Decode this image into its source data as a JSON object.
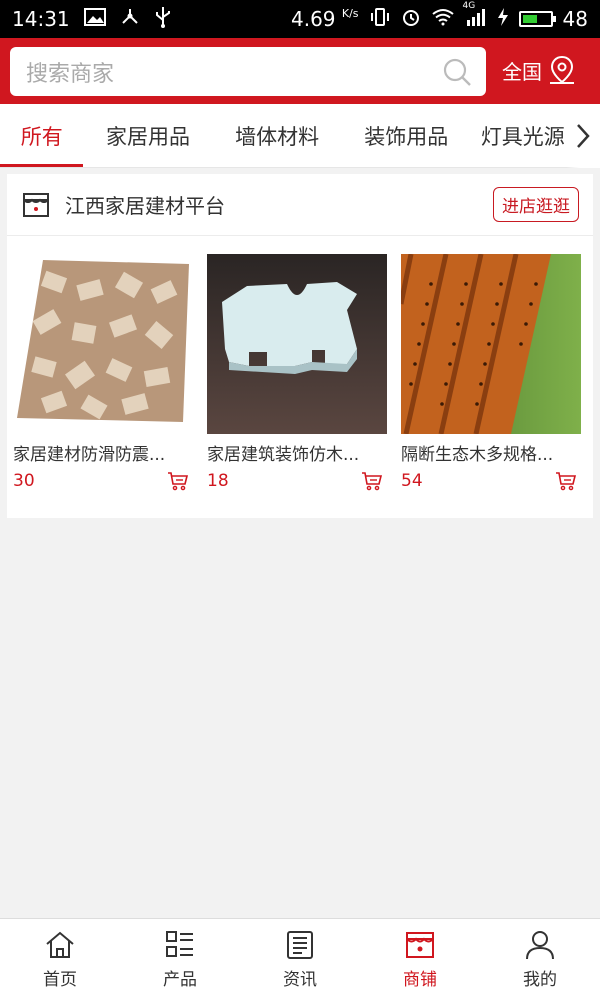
{
  "status_bar": {
    "time": "14:31",
    "speed": "4.69",
    "speed_unit": "K/s",
    "battery": "48",
    "network": "4G"
  },
  "header": {
    "search_placeholder": "搜索商家",
    "region_label": "全国"
  },
  "tabs": [
    {
      "label": "所有",
      "active": true
    },
    {
      "label": "家居用品",
      "active": false
    },
    {
      "label": "墙体材料",
      "active": false
    },
    {
      "label": "装饰用品",
      "active": false
    },
    {
      "label": "灯具光源",
      "active": false
    }
  ],
  "store": {
    "name": "江西家居建材平台",
    "visit_label": "进店逛逛",
    "products": [
      {
        "title": "家居建材防滑防震...",
        "price": "30"
      },
      {
        "title": "家居建筑装饰仿木...",
        "price": "18"
      },
      {
        "title": "隔断生态木多规格...",
        "price": "54"
      }
    ]
  },
  "bottom_nav": [
    {
      "label": "首页",
      "icon": "home-icon",
      "active": false
    },
    {
      "label": "产品",
      "icon": "product-list-icon",
      "active": false
    },
    {
      "label": "资讯",
      "icon": "news-icon",
      "active": false
    },
    {
      "label": "商铺",
      "icon": "shop-icon",
      "active": true
    },
    {
      "label": "我的",
      "icon": "user-icon",
      "active": false
    }
  ],
  "colors": {
    "brand": "#d0171f",
    "background": "#f2f2f2"
  }
}
